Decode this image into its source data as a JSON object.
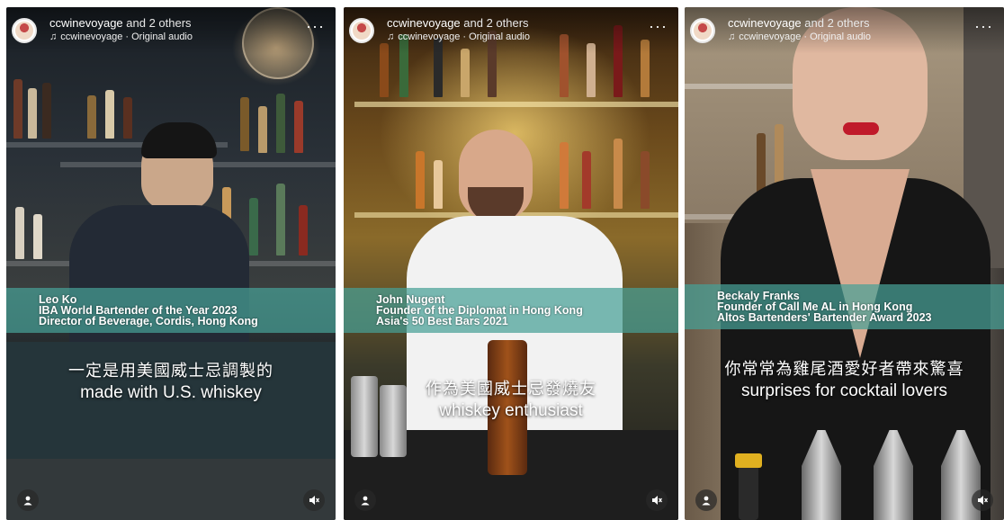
{
  "reels": [
    {
      "author": "ccwinevoyage",
      "others": " and 2 others",
      "audio": "ccwinevoyage · Original audio",
      "name_lines": [
        "Leo Ko",
        "IBA World Bartender of the Year 2023",
        "Director of Beverage, Cordis, Hong Kong"
      ],
      "subtitle_zh": "一定是用美國威士忌調製的",
      "subtitle_en": "made with U.S. whiskey"
    },
    {
      "author": "ccwinevoyage",
      "others": " and 2 others",
      "audio": "ccwinevoyage · Original audio",
      "name_lines": [
        "John Nugent",
        "Founder of the Diplomat in Hong Kong",
        "Asia's 50 Best Bars 2021"
      ],
      "subtitle_zh": "作為美國威士忌發燒友",
      "subtitle_en": "whiskey enthusiast"
    },
    {
      "author": "ccwinevoyage",
      "others": " and 2 others",
      "audio": "ccwinevoyage · Original audio",
      "name_lines": [
        "Beckaly Franks",
        "Founder of Call Me AL in Hong Kong",
        "Altos Bartenders' Bartender Award 2023"
      ],
      "subtitle_zh": "你常常為雞尾酒愛好者帶來驚喜",
      "subtitle_en": "surprises for cocktail lovers"
    }
  ],
  "icons": {
    "more": "more-options-icon",
    "note": "music-note-icon",
    "user": "user-icon",
    "mute": "muted-speaker-icon"
  }
}
